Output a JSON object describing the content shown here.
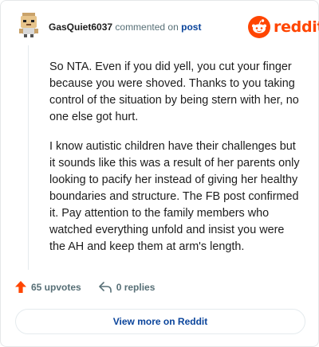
{
  "header": {
    "username": "GasQuiet6037",
    "action_text": "commented on",
    "post_link": "post",
    "brand": "reddit"
  },
  "comment": {
    "paragraphs": [
      "So NTA. Even if you did yell, you cut your finger because you were shoved. Thanks to you taking control of the situation by being stern with her, no one else got hurt.",
      "I know autistic children have their challenges but it sounds like this was a result of her parents only looking to pacify her instead of giving her healthy boundaries and structure. The FB post confirmed it. Pay attention to the family members who watched everything unfold and insist you were the AH and keep them at arm's length."
    ]
  },
  "actions": {
    "upvotes": "65 upvotes",
    "replies": "0 replies",
    "upvote_icon": "upvote-arrow-icon",
    "reply_icon": "reply-arrow-icon"
  },
  "footer": {
    "view_more": "View more on Reddit"
  },
  "colors": {
    "brand": "#ff4500",
    "link": "#0a449b",
    "muted": "#576f76",
    "text": "#1c1c1c"
  }
}
